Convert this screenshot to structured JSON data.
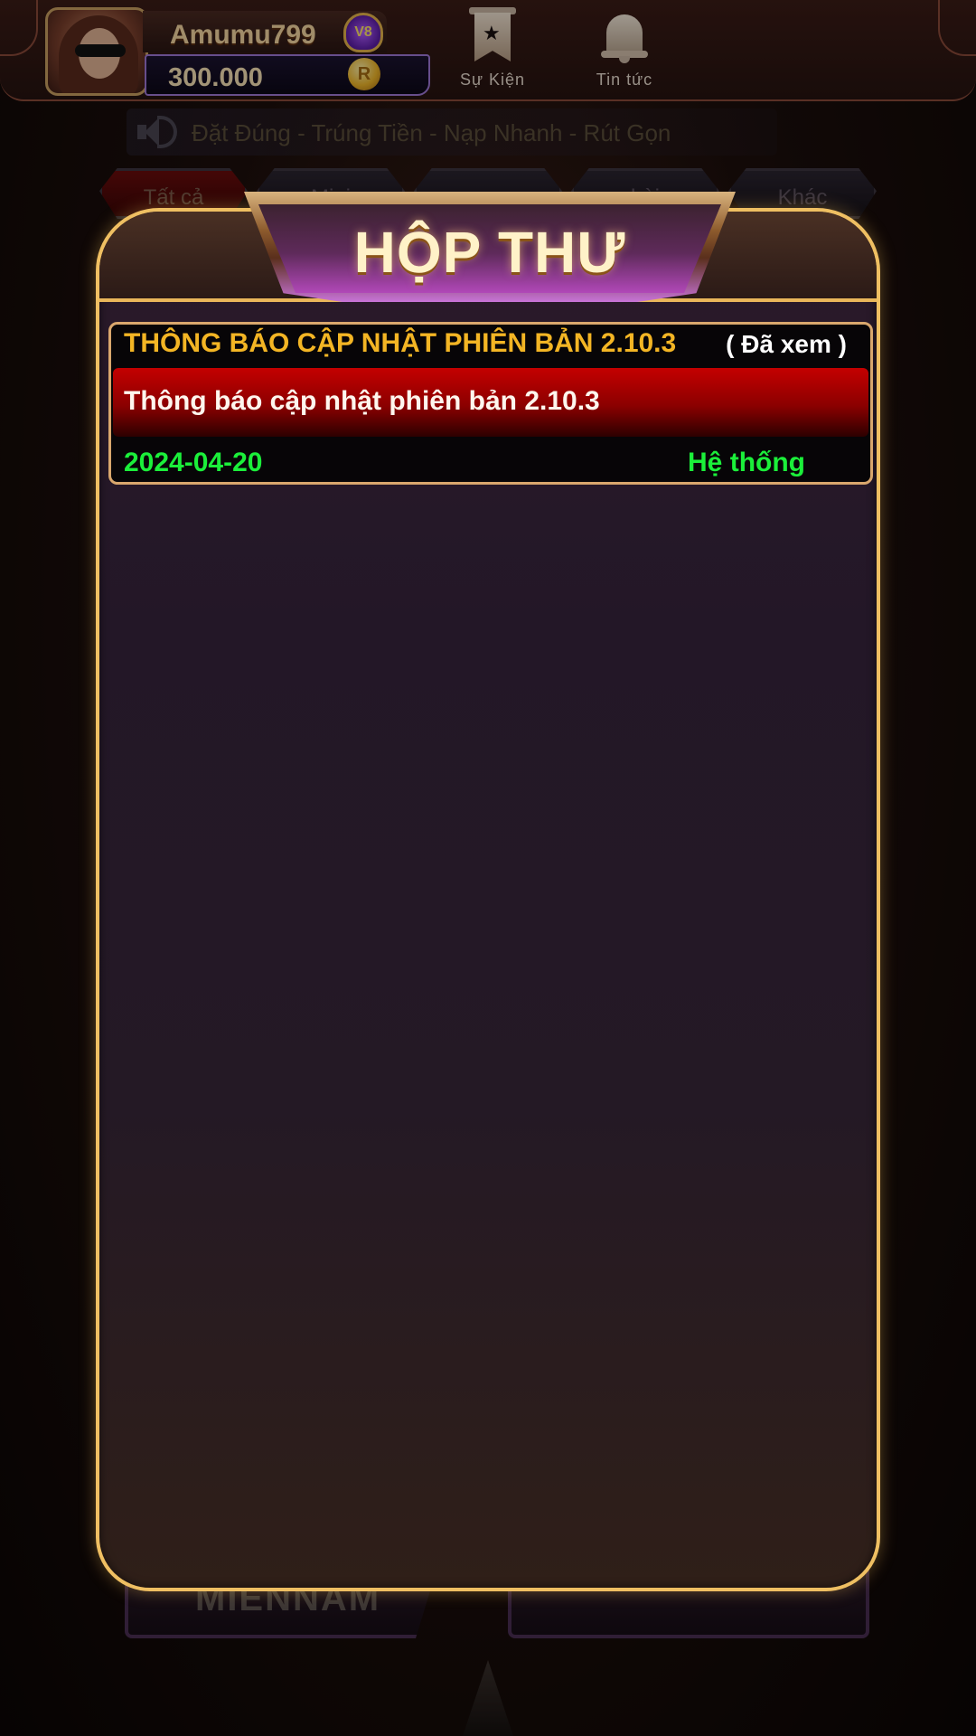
{
  "header": {
    "username": "Amumu799",
    "vip_level": "V8",
    "balance": "300.000",
    "coin_symbol": "R",
    "events_label": "Sự Kiện",
    "news_label": "Tin tức"
  },
  "marquee": {
    "text": "Đặt Đúng  - Trúng Tiền - Nạp Nhanh - Rút Gọn"
  },
  "tabs": [
    {
      "label": "Tất cả",
      "active": true
    },
    {
      "label": "Mini",
      "active": false
    },
    {
      "label": "",
      "active": false
    },
    {
      "label": "bài",
      "active": false
    },
    {
      "label": "Khác",
      "active": false
    }
  ],
  "background": {
    "tile_left_label": "MIENNAM"
  },
  "dialog": {
    "title": "HỘP THƯ",
    "messages": [
      {
        "title": "THÔNG BÁO CẬP NHẬT PHIÊN BẢN 2.10.3",
        "status": "( Đã xem )",
        "body": "Thông báo cập nhật phiên bản 2.10.3",
        "date": "2024-04-20",
        "sender": "Hệ thống"
      }
    ]
  },
  "colors": {
    "gold_border": "#efbf62",
    "message_title": "#f3b524",
    "message_meta": "#1bef3a",
    "message_band": "#c40000"
  }
}
